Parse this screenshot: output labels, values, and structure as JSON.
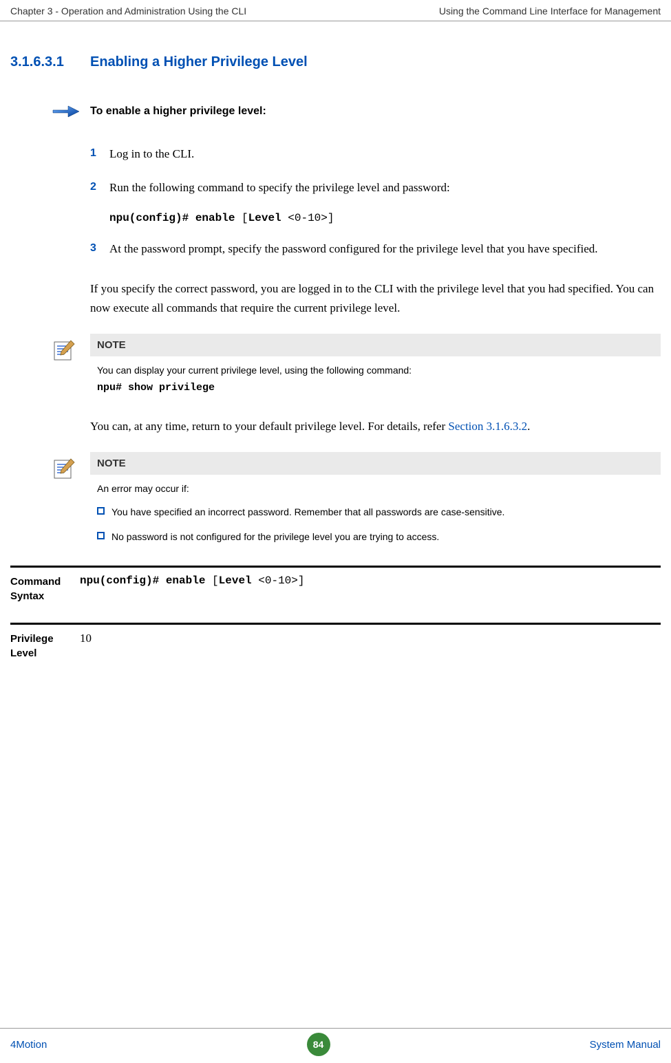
{
  "header": {
    "left": "Chapter 3 - Operation and Administration Using the CLI",
    "right": "Using the Command Line Interface for Management"
  },
  "section": {
    "number": "3.1.6.3.1",
    "title": "Enabling a Higher Privilege Level"
  },
  "procedure": {
    "title": "To enable a higher privilege level:",
    "steps": {
      "s1": {
        "num": "1",
        "text": "Log in to the CLI."
      },
      "s2": {
        "num": "2",
        "text": "Run the following command to specify the privilege level and password:"
      },
      "s2code": {
        "p1": "npu(config)# enable",
        "p2": " [",
        "p3": "Level",
        "p4": " <0-10>]"
      },
      "s3": {
        "num": "3",
        "text": "At the password prompt, specify the password configured for the privilege level that you have specified."
      }
    }
  },
  "para1": "If you specify the correct password, you are logged in to the CLI with the privilege level that you had specified. You can now execute all commands that require the current privilege level.",
  "note1": {
    "header": "NOTE",
    "body": "You can display your current privilege level, using the following command:",
    "code": "npu# show privilege"
  },
  "para2": {
    "text": "You can, at any time, return to your default privilege level. For details, refer ",
    "link": "Section 3.1.6.3.2",
    "suffix": "."
  },
  "note2": {
    "header": "NOTE",
    "intro": "An error may occur if:",
    "item1": "You have specified an incorrect password. Remember that all passwords are case-sensitive.",
    "item2": "No password is not configured for the privilege level you are trying to access."
  },
  "defs": {
    "cmdLabel": "Command Syntax",
    "cmd": {
      "p1": "npu(config)# enable",
      "p2": " [",
      "p3": "Level",
      "p4": " <0-10>]"
    },
    "privLabel": "Privilege Level",
    "privValue": "10"
  },
  "footer": {
    "left": "4Motion",
    "center": "84",
    "right": "System Manual"
  }
}
